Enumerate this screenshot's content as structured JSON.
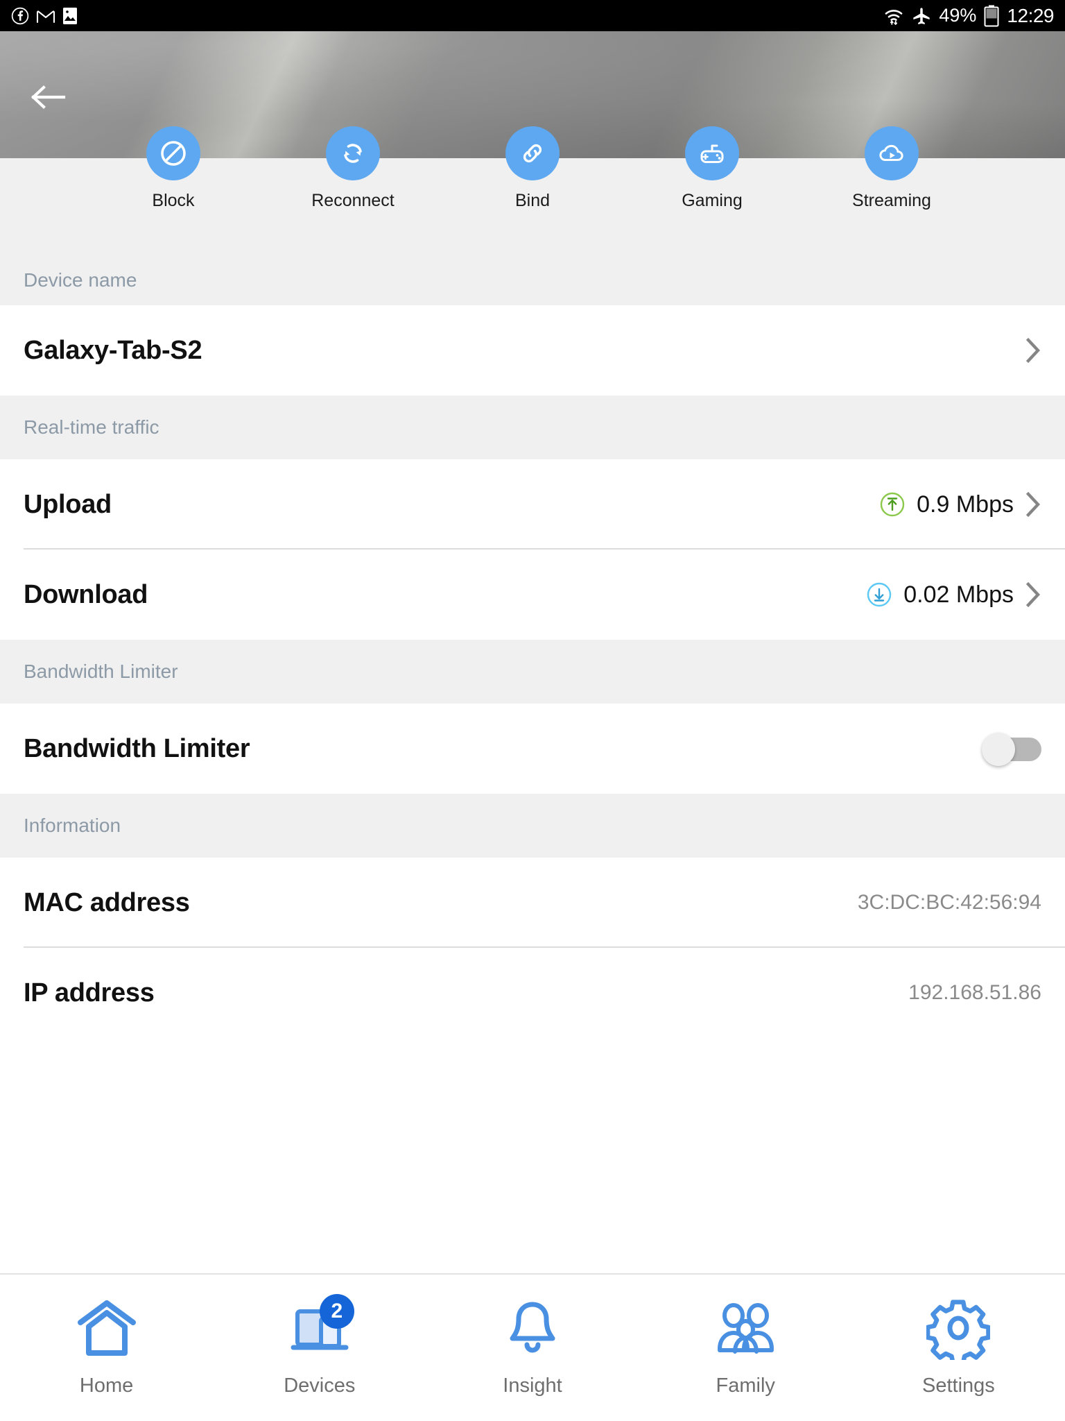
{
  "status_bar": {
    "left_icons": [
      "facebook-icon",
      "gmail-icon",
      "photo-icon"
    ],
    "wifi_icon": "wifi-transfer-icon",
    "airplane_icon": "airplane-mode-icon",
    "battery_percent": "49%",
    "battery_icon": "battery-icon",
    "time": "12:29"
  },
  "header": {
    "back_icon": "back-arrow-icon"
  },
  "quick_actions": [
    {
      "label": "Block",
      "icon": "block-icon"
    },
    {
      "label": "Reconnect",
      "icon": "refresh-icon"
    },
    {
      "label": "Bind",
      "icon": "link-icon"
    },
    {
      "label": "Gaming",
      "icon": "gamepad-icon"
    },
    {
      "label": "Streaming",
      "icon": "cloud-play-icon"
    }
  ],
  "sections": {
    "device_name": {
      "title": "Device name",
      "value": "Galaxy-Tab-S2"
    },
    "realtime_traffic": {
      "title": "Real-time traffic",
      "upload": {
        "label": "Upload",
        "value": "0.9 Mbps",
        "icon": "upload-circle-icon",
        "icon_color": "#8BC94B"
      },
      "download": {
        "label": "Download",
        "value": "0.02 Mbps",
        "icon": "download-circle-icon",
        "icon_color": "#5BC8F5"
      }
    },
    "bandwidth_limiter": {
      "title": "Bandwidth Limiter",
      "label": "Bandwidth Limiter",
      "toggle_state": "off"
    },
    "information": {
      "title": "Information",
      "mac": {
        "label": "MAC address",
        "value": "3C:DC:BC:42:56:94"
      },
      "ip": {
        "label": "IP address",
        "value": "192.168.51.86"
      }
    }
  },
  "bottom_nav": [
    {
      "label": "Home",
      "icon": "home-icon",
      "badge": ""
    },
    {
      "label": "Devices",
      "icon": "devices-icon",
      "badge": "2"
    },
    {
      "label": "Insight",
      "icon": "bell-icon",
      "badge": ""
    },
    {
      "label": "Family",
      "icon": "family-icon",
      "badge": ""
    },
    {
      "label": "Settings",
      "icon": "gear-icon",
      "badge": ""
    }
  ],
  "colors": {
    "accent_blue": "#5da8f0",
    "nav_blue": "#4a90e2",
    "badge_blue": "#1565d8",
    "section_bg": "#f0f0f0",
    "section_text": "#8c99a6"
  }
}
